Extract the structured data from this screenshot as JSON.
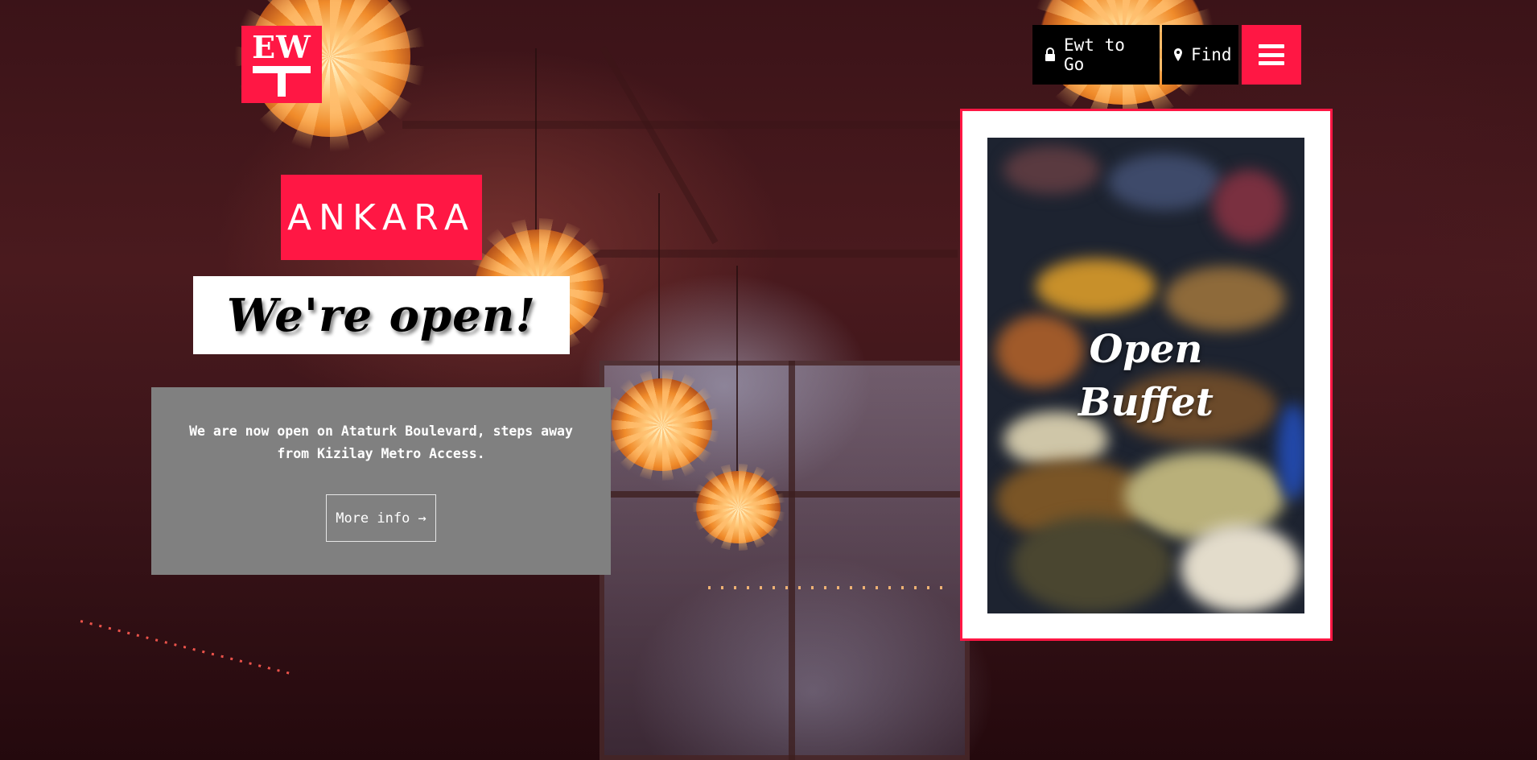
{
  "brand": {
    "logo_text": "EW",
    "accent_color": "#ff1744"
  },
  "nav": {
    "to_go_label": "Ewt to Go",
    "to_go_icon": "lock-icon",
    "find_label": "Find",
    "find_icon": "map-pin-icon",
    "menu_icon": "hamburger-menu-icon"
  },
  "hero": {
    "city": "ANKARA",
    "headline": "We're open!",
    "description": "We are now open on Ataturk Boulevard, steps away from Kizilay Metro Access.",
    "cta_label": "More info →"
  },
  "promo": {
    "line1": "Open",
    "line2": "Buffet"
  }
}
